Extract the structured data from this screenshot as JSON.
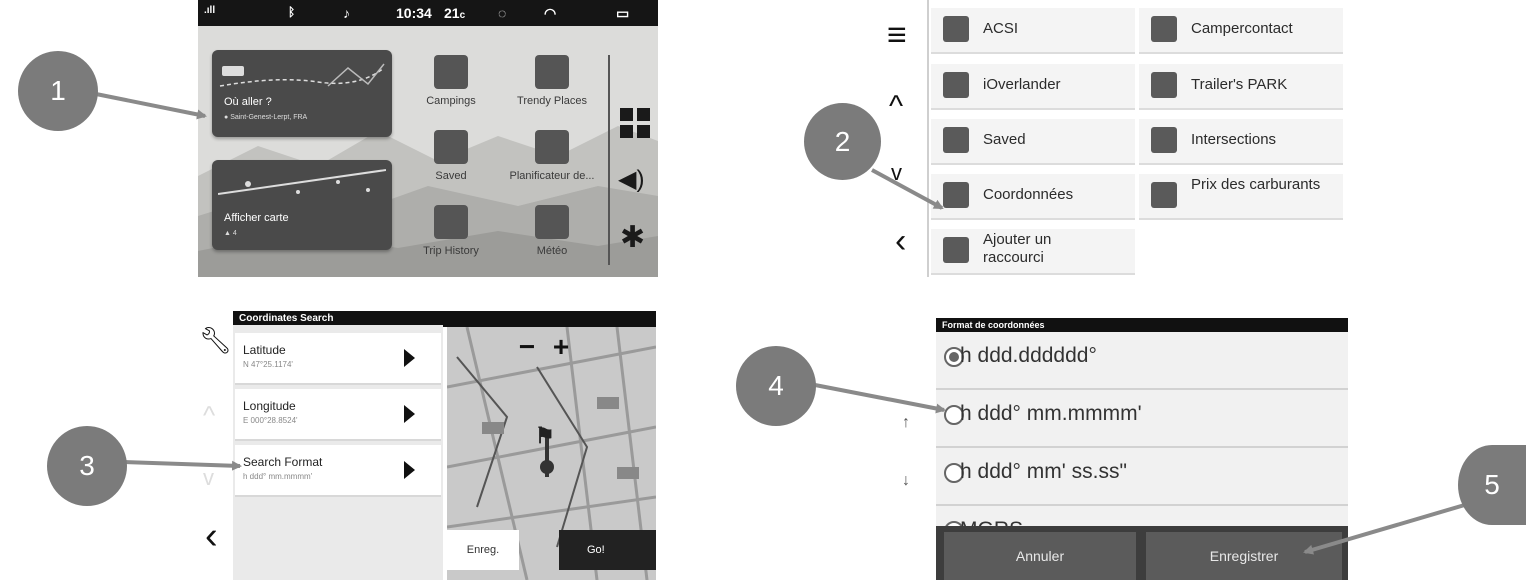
{
  "callouts": [
    {
      "label": "1"
    },
    {
      "label": "2"
    },
    {
      "label": "3"
    },
    {
      "label": "4"
    },
    {
      "label": "5"
    }
  ],
  "panel1": {
    "status": {
      "time": "10:34",
      "temp": "21",
      "temp_unit": "c"
    },
    "where_to": {
      "title": "Où aller ?",
      "location": "Saint-Genest-Lerpt, FRA"
    },
    "view_map": {
      "title": "Afficher carte",
      "sub": "4"
    },
    "apps": [
      {
        "label": "Campings",
        "icon": "tent-icon"
      },
      {
        "label": "Trendy Places",
        "icon": "camper-icon"
      },
      {
        "label": "Saved",
        "icon": "heart-icon"
      },
      {
        "label": "Planificateur de...",
        "icon": "planner-icon"
      },
      {
        "label": "Trip History",
        "icon": "trip-history-icon"
      },
      {
        "label": "Météo",
        "icon": "weather-icon"
      }
    ],
    "side": [
      "grid-icon",
      "volume-icon",
      "gear-icon"
    ]
  },
  "panel2": {
    "categories": [
      {
        "label": "ACSI",
        "icon": "acsi-icon"
      },
      {
        "label": "Campercontact",
        "icon": "campercontact-icon"
      },
      {
        "label": "iOverlander",
        "icon": "ioverlander-icon"
      },
      {
        "label": "Trailer's PARK",
        "icon": "trailers-park-icon"
      },
      {
        "label": "Saved",
        "icon": "heart-icon"
      },
      {
        "label": "Intersections",
        "icon": "intersection-icon"
      },
      {
        "label": "Coordonnées",
        "icon": "crosshair-icon"
      },
      {
        "label": "Prix des carburants",
        "icon": "fuel-icon"
      },
      {
        "label": "Ajouter un raccourci",
        "icon": "shortcut-icon"
      }
    ]
  },
  "panel3": {
    "header": "Coordinates Search",
    "rows": [
      {
        "title": "Latitude",
        "sub": "N 47°25.1174'"
      },
      {
        "title": "Longitude",
        "sub": "E 000°28.8524'"
      },
      {
        "title": "Search Format",
        "sub": "h ddd° mm.mmmm'"
      }
    ],
    "save": "Enreg.",
    "go": "Go!",
    "zoom_out": "−",
    "zoom_in": "+"
  },
  "panel4": {
    "header": "Format de coordonnées",
    "options": [
      {
        "label": "h ddd.dddddd°",
        "selected": true
      },
      {
        "label": "h ddd° mm.mmmm'",
        "selected": false
      },
      {
        "label": "h ddd° mm' ss.ss\"",
        "selected": false
      },
      {
        "label": "MGRS",
        "selected": false
      }
    ],
    "cancel": "Annuler",
    "save": "Enregistrer"
  }
}
